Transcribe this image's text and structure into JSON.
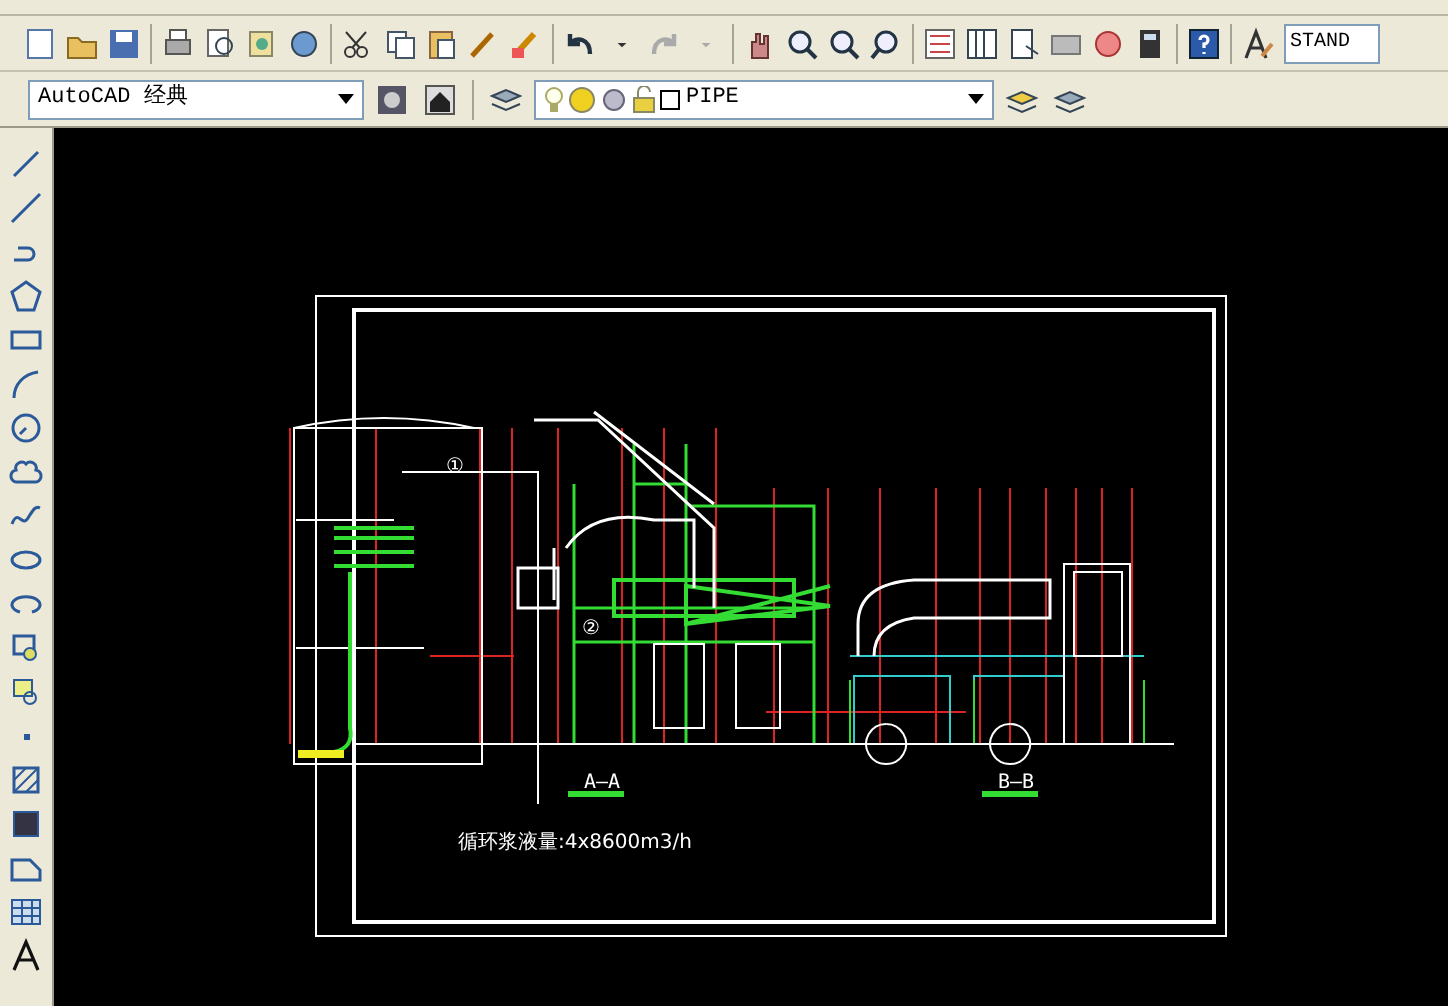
{
  "toolbar_2": {
    "workspace": "AutoCAD 经典",
    "layer": "PIPE"
  },
  "style_field": {
    "value": "STAND"
  },
  "drawing": {
    "markers": [
      "①",
      "②"
    ],
    "section_labels": [
      "A—A",
      "B—B"
    ],
    "note": "循环浆液量:4x8600m3/h"
  }
}
